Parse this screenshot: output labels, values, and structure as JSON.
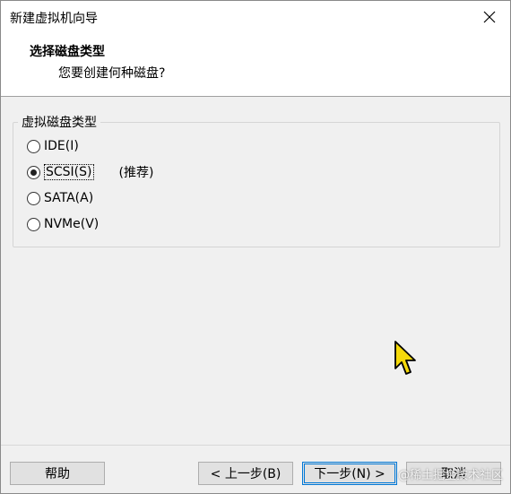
{
  "window": {
    "title": "新建虚拟机向导"
  },
  "header": {
    "title": "选择磁盘类型",
    "subtitle": "您要创建何种磁盘?"
  },
  "disk_type": {
    "group_label": "虚拟磁盘类型",
    "options": [
      {
        "label": "IDE(I)",
        "selected": false
      },
      {
        "label": "SCSI(S)",
        "selected": true
      },
      {
        "label": "SATA(A)",
        "selected": false
      },
      {
        "label": "NVMe(V)",
        "selected": false
      }
    ],
    "recommend_note": "(推荐)"
  },
  "footer": {
    "help_label": "帮助",
    "back_label": "< 上一步(B)",
    "next_label": "下一步(N) >",
    "cancel_label": "取消",
    "watermark": "@稀土掘金技术社区"
  },
  "colors": {
    "accent": "#0078d7",
    "cursor_fill": "#f5d90a"
  }
}
